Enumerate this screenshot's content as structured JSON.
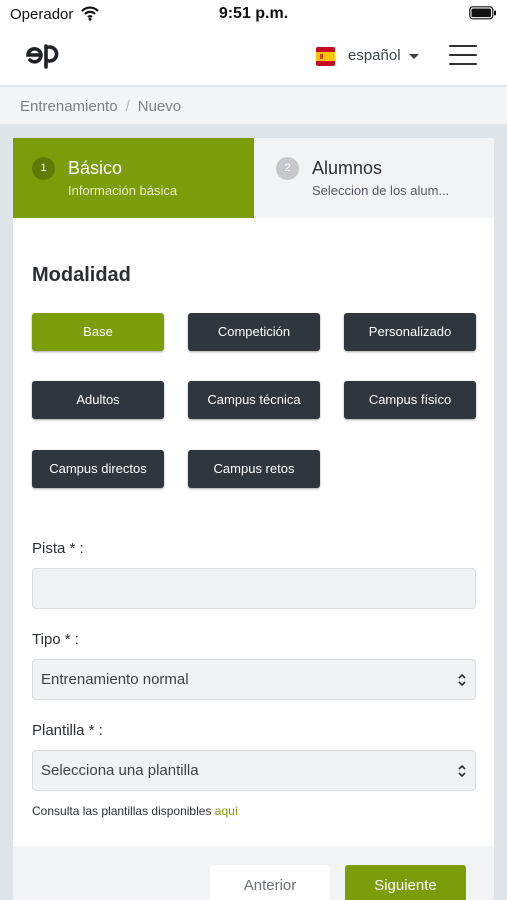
{
  "status_bar": {
    "carrier": "Operador",
    "time": "9:51 p.m."
  },
  "header": {
    "logo_text": "eP",
    "language": "español",
    "flag": "spain-flag-icon",
    "menu_icon": "hamburger-icon"
  },
  "breadcrumb": {
    "items": [
      "Entrenamiento",
      "Nuevo"
    ],
    "separator": "/"
  },
  "steps": [
    {
      "number": "1",
      "title": "Básico",
      "subtitle": "Información básica",
      "active": true
    },
    {
      "number": "2",
      "title": "Alumnos",
      "subtitle": "Seleccion de los alum...",
      "active": false
    }
  ],
  "modalidad": {
    "title": "Modalidad",
    "options": [
      {
        "label": "Base",
        "selected": true
      },
      {
        "label": "Competición",
        "selected": false
      },
      {
        "label": "Personalizado",
        "selected": false
      },
      {
        "label": "Adultos",
        "selected": false
      },
      {
        "label": "Campus técnica",
        "selected": false
      },
      {
        "label": "Campus físico",
        "selected": false
      },
      {
        "label": "Campus directos",
        "selected": false
      },
      {
        "label": "Campus retos",
        "selected": false
      }
    ]
  },
  "form": {
    "pista": {
      "label": "Pista * :",
      "value": ""
    },
    "tipo": {
      "label": "Tipo * :",
      "value": "Entrenamiento normal"
    },
    "plantilla": {
      "label": "Plantilla * :",
      "value": "Selecciona una plantilla"
    },
    "help_text": "Consulta las plantillas disponibles",
    "help_link": "aquí"
  },
  "footer": {
    "prev_label": "Anterior",
    "next_label": "Siguiente"
  },
  "colors": {
    "accent": "#7c9d0a",
    "dark_button": "#2f363d"
  }
}
